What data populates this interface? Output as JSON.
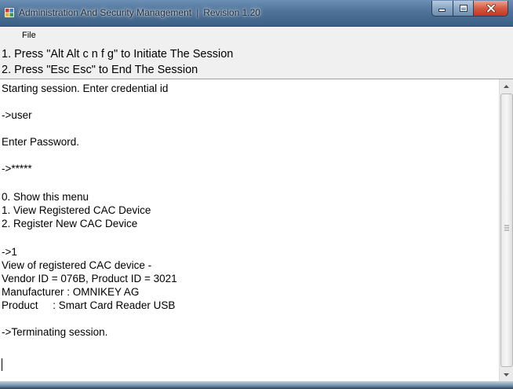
{
  "window": {
    "title": "Administration And Security Management",
    "title_separator": "|",
    "revision": "Revision 1.20",
    "icons": {
      "app": "app-window-icon",
      "minimize": "minimize-icon",
      "maximize": "maximize-icon",
      "close": "close-icon"
    }
  },
  "menu": {
    "items": [
      {
        "label": "File"
      }
    ]
  },
  "instructions": [
    "1. Press \"Alt Alt c n f g\" to Initiate The Session",
    "2. Press \"Esc Esc\" to End The Session"
  ],
  "console": {
    "lines": [
      "Starting session. Enter credential id",
      "",
      "->user",
      "",
      "Enter Password.",
      "",
      "->*****",
      "",
      "0. Show this menu",
      "1. View Registered CAC Device",
      "2. Register New CAC Device",
      "",
      "->1",
      "View of registered CAC device -",
      "Vendor ID = 076B, Product ID = 3021",
      "Manufacturer : OMNIKEY AG",
      "Product     : Smart Card Reader USB",
      "",
      "->Terminating session."
    ]
  },
  "scrollbar": {
    "icons": {
      "up": "scroll-up-arrow-icon",
      "down": "scroll-down-arrow-icon",
      "grip": "scroll-grip-icon"
    }
  },
  "colors": {
    "title_bar": "#4f7297",
    "close_button": "#c2381e",
    "panel_background": "#f0f0f0",
    "console_background": "#ffffff"
  }
}
